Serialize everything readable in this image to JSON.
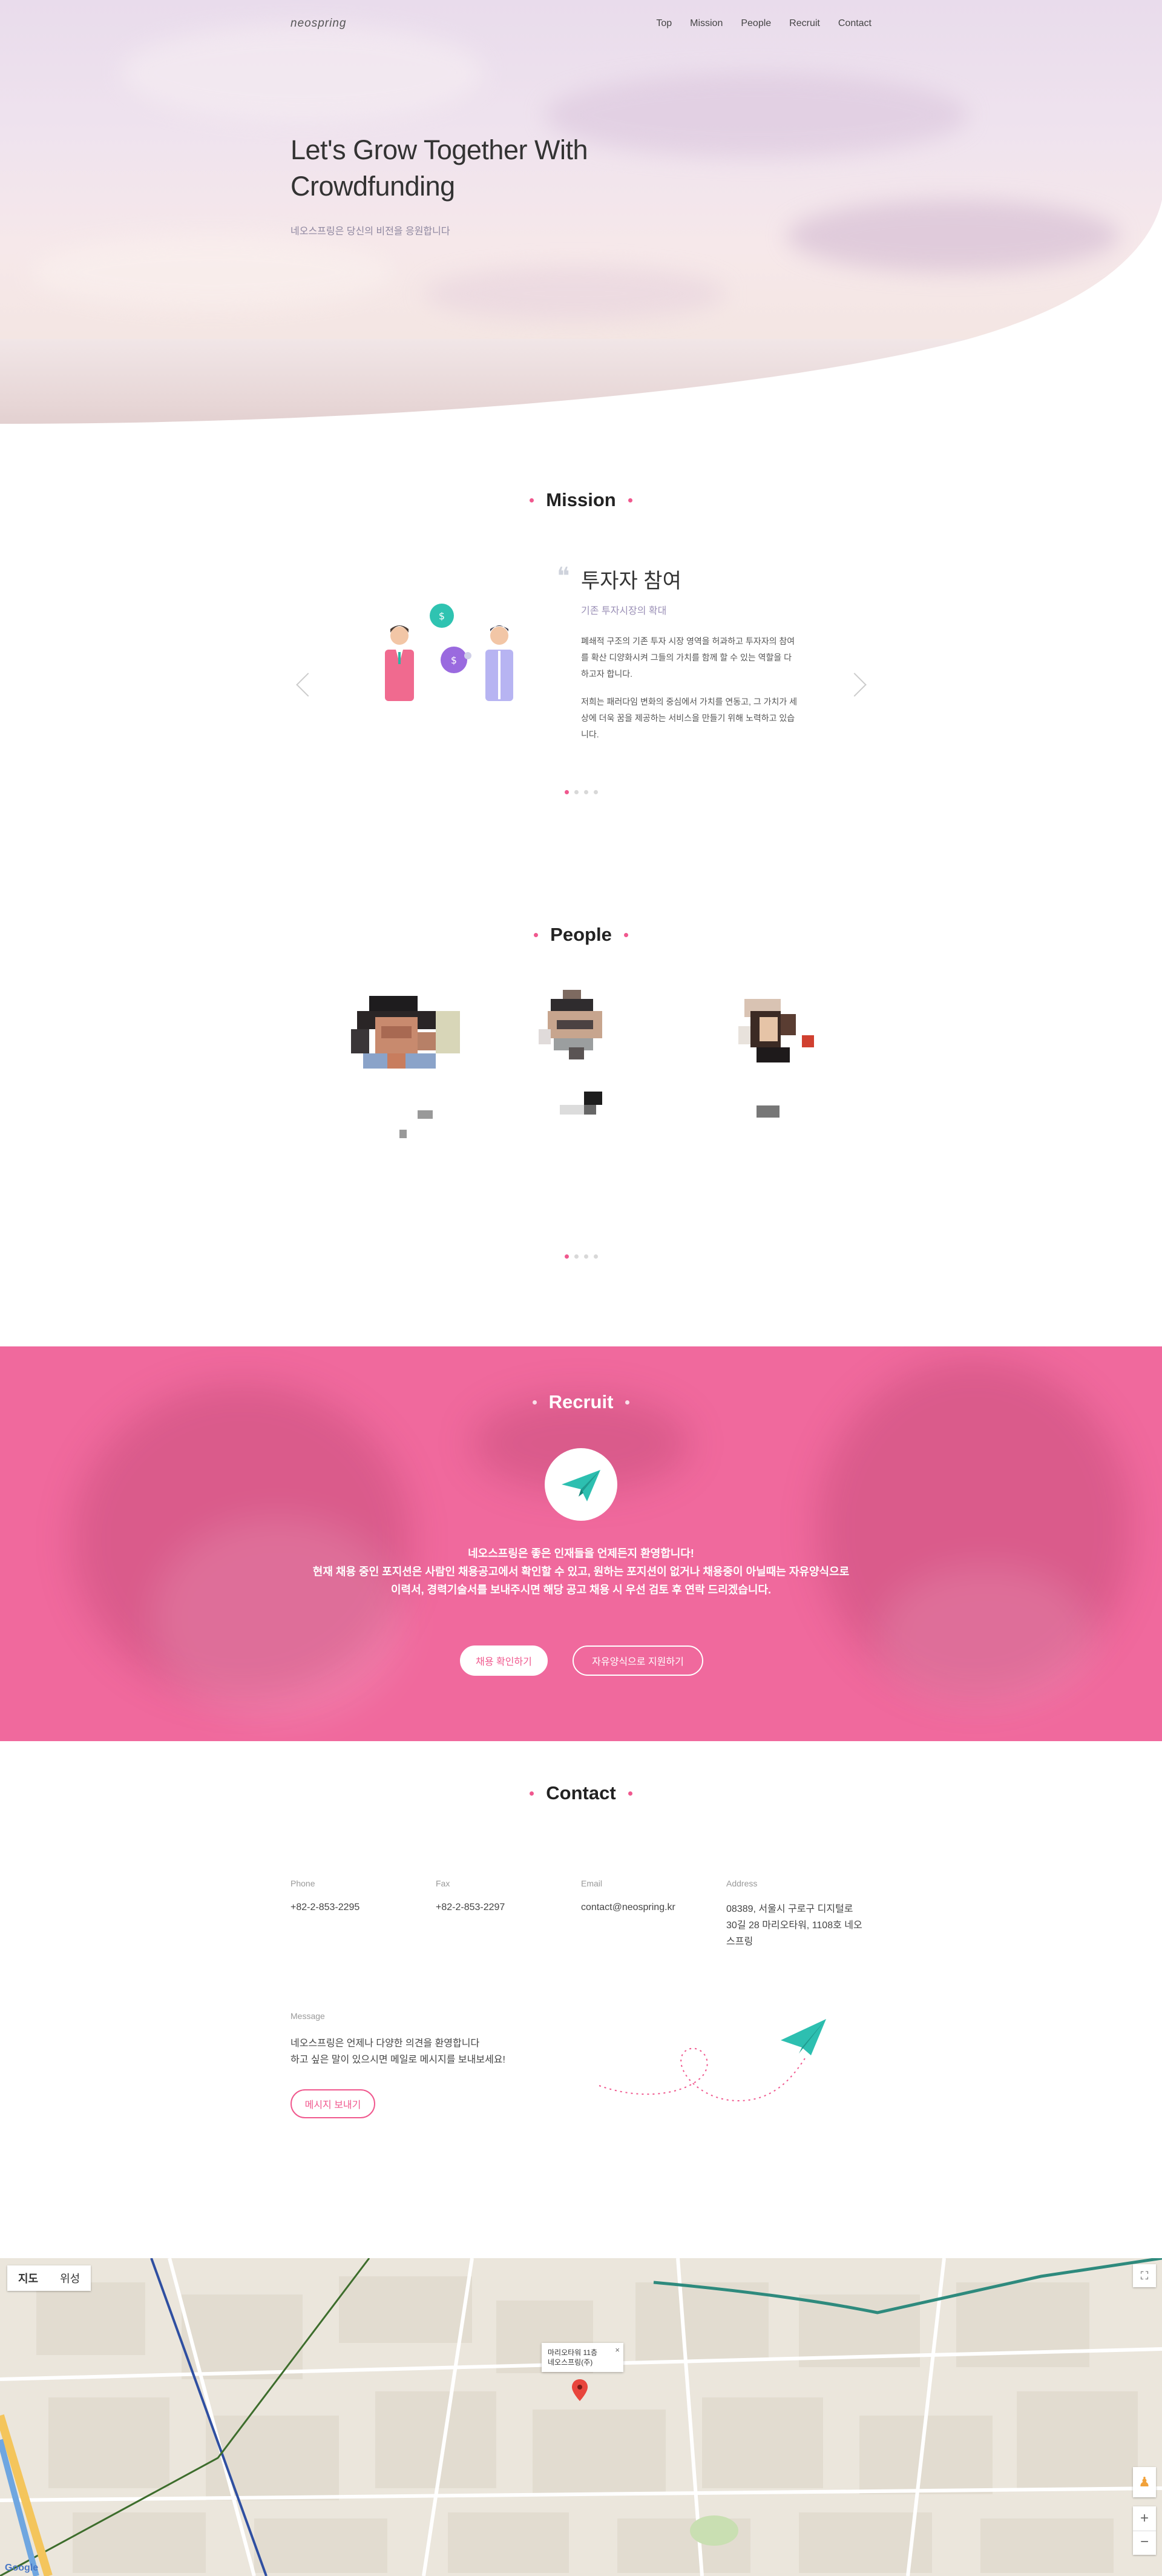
{
  "nav": {
    "logo": "neospring",
    "items": [
      "Top",
      "Mission",
      "People",
      "Recruit",
      "Contact"
    ]
  },
  "hero": {
    "title_line1": "Let's Grow Together With",
    "title_line2": "Crowdfunding",
    "subtitle": "네오스프링은 당신의 비전을 응원합니다"
  },
  "mission": {
    "title": "Mission",
    "heading": "투자자 참여",
    "subheading": "기존 투자시장의 확대",
    "para1": "폐쇄적 구조의 기존 투자 시장 영역을 허과하고 투자자의 참여를 확산 디양화시켜 그들의 가치를 함께 할 수 있는 역할을 다하고자 합니다.",
    "para2": "저희는 패러다임 변화의 중심에서 가치를 연동고, 그 가치가 세상에 더욱 꿈을 제공하는 서비스을 만들기 위해 노력하고 있습니다.",
    "page_dots": 4,
    "active_dot": 0
  },
  "people": {
    "title": "People",
    "page_dots": 4,
    "active_dot": 0
  },
  "recruit": {
    "title": "Recruit",
    "line1": "네오스프링은 좋은 인재들을 언제든지 환영합니다!",
    "line2": "현재 채용 중인 포지션은 사람인 채용공고에서 확인할 수 있고, 원하는 포지션이 없거나 채용중이 아닐때는 자유양식으로",
    "line3": "이력서, 경력기술서를 보내주시면 해당 공고 채용 시 우선 검토 후 연락 드리겠습니다.",
    "button_primary": "채용 확인하기",
    "button_secondary": "자유양식으로 지원하기"
  },
  "contact": {
    "title": "Contact",
    "phone_label": "Phone",
    "phone": "+82-2-853-2295",
    "fax_label": "Fax",
    "fax": "+82-2-853-2297",
    "email_label": "Email",
    "email": "contact@neospring.kr",
    "address_label": "Address",
    "address_line1": "08389, 서울시 구로구 디지털로",
    "address_line2": "30길 28 마리오타워, 1108호 네오",
    "address_line3": "스프링",
    "message_label": "Message",
    "message_line1": "네오스프링은 언제나 다양한 의견을 환영합니다",
    "message_line2": "하고 싶은 말이 있으시면 메일로 메시지를 보내보세요!",
    "message_button": "메시지 보내기"
  },
  "map": {
    "tab_map": "지도",
    "tab_satellite": "위성",
    "info_line1": "마리오타워 11층",
    "info_line2": "네오스프링(주)",
    "info_close": "×",
    "zoom_in": "+",
    "zoom_out": "−",
    "google": "Google"
  },
  "colors": {
    "accent": "#f0588e",
    "recruit_bg": "#f0699d",
    "plane": "#2dbfb0"
  }
}
